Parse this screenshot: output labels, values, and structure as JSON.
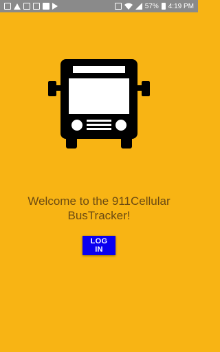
{
  "status_bar": {
    "left_icons": [
      "mail-icon",
      "drive-icon",
      "gallery-icon",
      "image-icon",
      "flipboard-icon",
      "play-store-icon"
    ],
    "right_icons": [
      "nfc-icon",
      "wifi-icon",
      "signal-icon",
      "battery-icon"
    ],
    "battery_percent": "57%",
    "time": "4:19 PM"
  },
  "main": {
    "logo_icon": "bus-icon",
    "welcome_line1": "Welcome to the 911Cellular",
    "welcome_line2": "BusTracker!",
    "login_label": "LOG IN"
  },
  "colors": {
    "background": "#F8B414",
    "status_bar": "#8A8A8A",
    "welcome_text": "#6B4A12",
    "button": "#0A00F0",
    "bus": "#000000"
  }
}
